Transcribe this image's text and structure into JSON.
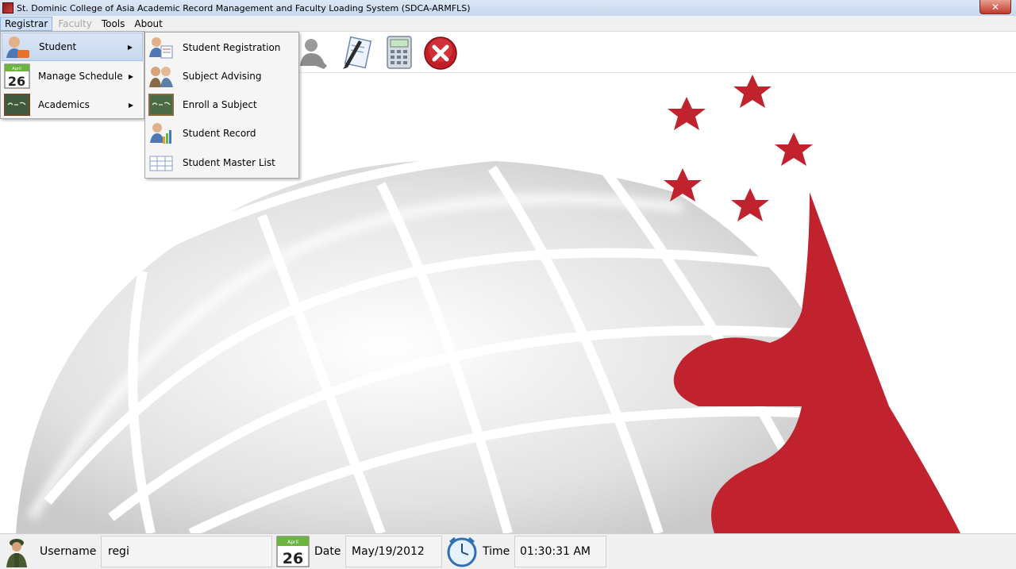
{
  "window": {
    "title": "St. Dominic College of Asia Academic Record Management and Faculty Loading System (SDCA-ARMFLS)",
    "close_label": "✕"
  },
  "menubar": {
    "items": [
      "Registrar",
      "Faculty",
      "Tools",
      "About"
    ]
  },
  "registrar_menu": {
    "items": [
      {
        "label": "Student",
        "arrow": "▶"
      },
      {
        "label": "Manage Schedule",
        "arrow": "▶"
      },
      {
        "label": "Academics",
        "arrow": "▶"
      }
    ]
  },
  "student_submenu": {
    "items": [
      "Student Registration",
      "Subject Advising",
      "Enroll a Subject",
      "Student Record",
      "Student Master List"
    ]
  },
  "calendar_icon": {
    "month": "April",
    "day": "26"
  },
  "statusbar": {
    "username_label": "Username",
    "username_value": "regi",
    "date_label": "Date",
    "date_value": "May/19/2012",
    "time_label": "Time",
    "time_value": "01:30:31 AM"
  },
  "colors": {
    "brand_red": "#c0222e",
    "menu_highlight": "#cde0f7",
    "statusbar_bg": "#f0f0f0"
  },
  "icons": {
    "toolbar": [
      "user-icon",
      "edit-document-icon",
      "calculator-icon",
      "exit-icon"
    ],
    "registrar_menu": [
      "student-icon",
      "calendar-icon",
      "chalkboard-icon"
    ],
    "student_submenu": [
      "student-registration-icon",
      "subject-advising-icon",
      "chalkboard-icon",
      "student-record-icon",
      "master-list-icon"
    ],
    "statusbar": [
      "soldier-avatar-icon",
      "calendar-icon",
      "clock-icon"
    ]
  }
}
